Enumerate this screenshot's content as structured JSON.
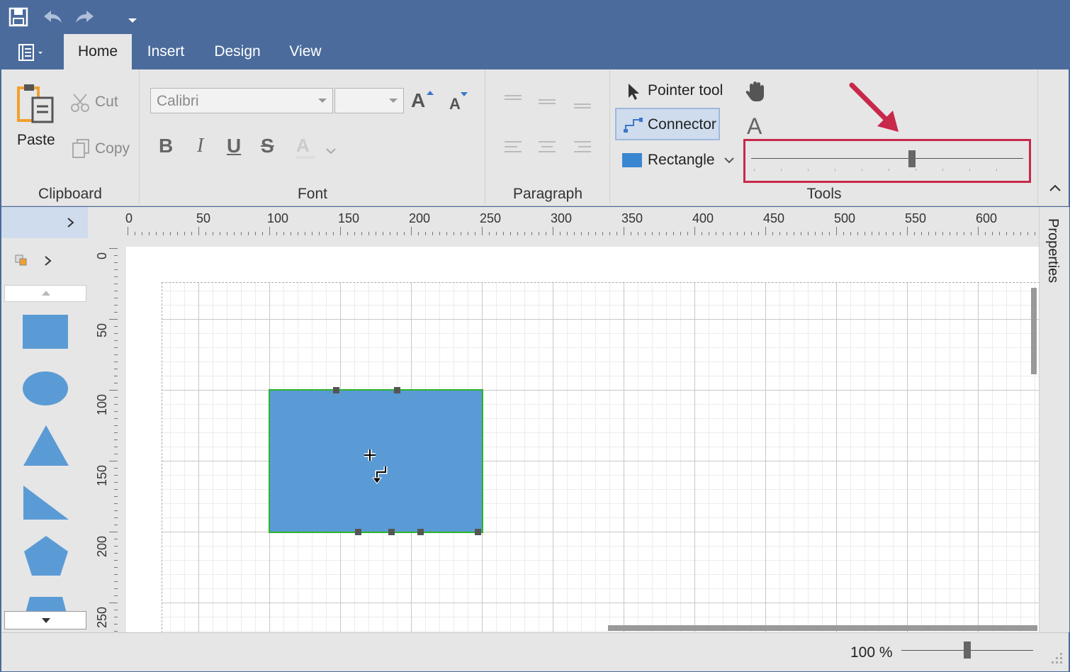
{
  "quick_access": {
    "save_icon": "save-icon",
    "undo_icon": "undo-icon",
    "redo_icon": "redo-icon",
    "customize_icon": "dropdown-arrow-icon"
  },
  "tabs": [
    {
      "label": "Home",
      "active": true
    },
    {
      "label": "Insert",
      "active": false
    },
    {
      "label": "Design",
      "active": false
    },
    {
      "label": "View",
      "active": false
    }
  ],
  "clipboard": {
    "paste_label": "Paste",
    "cut_label": "Cut",
    "copy_label": "Copy",
    "group_label": "Clipboard"
  },
  "font": {
    "family_value": "Calibri",
    "size_value": "",
    "group_label": "Font",
    "bold_label": "B",
    "italic_label": "I",
    "underline_label": "U",
    "strike_label": "S",
    "color_label": "A",
    "grow_label": "A",
    "shrink_label": "A"
  },
  "paragraph": {
    "group_label": "Paragraph"
  },
  "tools": {
    "pointer_label": "Pointer tool",
    "connector_label": "Connector",
    "rectangle_label": "Rectangle",
    "text_tool_label": "A",
    "group_label": "Tools",
    "connector_selected": true,
    "slider_value": 0.59
  },
  "ruler": {
    "h_labels": [
      "0",
      "50",
      "100",
      "150",
      "200",
      "250",
      "300",
      "350",
      "400",
      "450",
      "500",
      "550",
      "600"
    ],
    "v_labels": [
      "0",
      "50",
      "100",
      "150",
      "200",
      "250"
    ]
  },
  "properties_label": "Properties",
  "status": {
    "zoom_label": "100 %",
    "zoom_value": 0.5
  },
  "colors": {
    "title_bar": "#4b6b9c",
    "ribbon": "#e6e6e6",
    "shape_fill": "#5b9bd5",
    "selection_border": "#2bb52b",
    "highlight_box": "#c8284a"
  }
}
